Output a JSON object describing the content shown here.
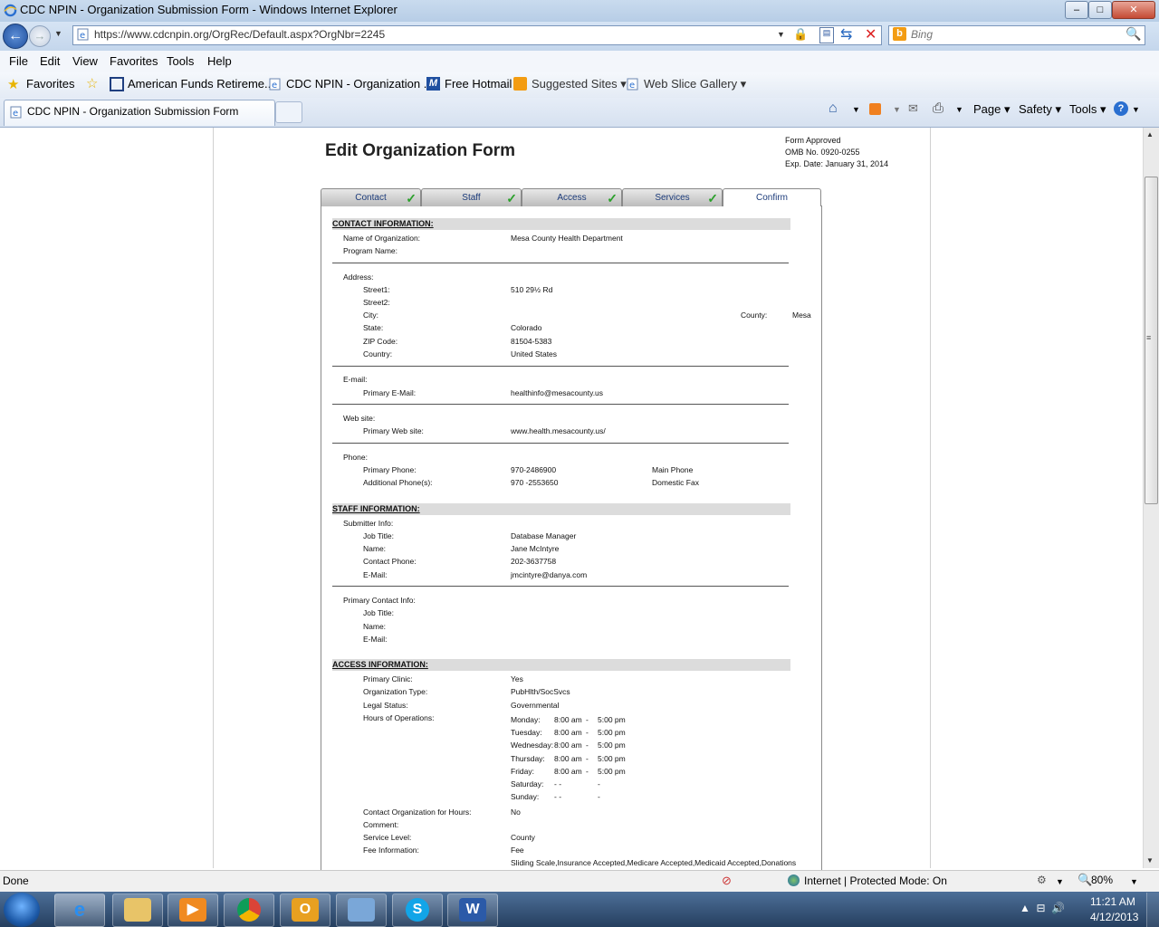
{
  "window": {
    "title": "CDC NPIN - Organization Submission Form - Windows Internet Explorer",
    "controls": {
      "minimize": "–",
      "maximize": "□",
      "close": "✕"
    }
  },
  "nav": {
    "url": "https://www.cdcnpin.org/OrgRec/Default.aspx?OrgNbr=2245",
    "search_placeholder": "Bing"
  },
  "menubar": [
    "File",
    "Edit",
    "View",
    "Favorites",
    "Tools",
    "Help"
  ],
  "favorites_bar": {
    "favorites_label": "Favorites",
    "items": [
      "American Funds Retireme...",
      "CDC NPIN - Organization ...",
      "Free Hotmail",
      "Suggested Sites ▾",
      "Web Slice Gallery ▾"
    ]
  },
  "tabs": {
    "active": "CDC NPIN - Organization Submission Form"
  },
  "command_bar": {
    "page": "Page ▾",
    "safety": "Safety ▾",
    "tools": "Tools ▾"
  },
  "form": {
    "title": "Edit Organization Form",
    "omb": {
      "line1": "Form Approved",
      "line2": "OMB No. 0920-0255",
      "line3": "Exp. Date: January 31, 2014"
    },
    "wizard_tabs": [
      {
        "label": "Contact",
        "done": true
      },
      {
        "label": "Staff",
        "done": true
      },
      {
        "label": "Access",
        "done": true
      },
      {
        "label": "Services",
        "done": true
      },
      {
        "label": "Confirm",
        "done": false
      }
    ],
    "contact": {
      "header": "CONTACT INFORMATION:",
      "org_name_label": "Name of Organization:",
      "org_name": "Mesa County Health Department",
      "program_label": "Program Name:",
      "address_label": "Address:",
      "street1_label": "Street1:",
      "street1": "510 29½ Rd",
      "street2_label": "Street2:",
      "city_label": "City:",
      "county_label": "County:",
      "county": "Mesa",
      "state_label": "State:",
      "state": "Colorado",
      "zip_label": "ZIP Code:",
      "zip": "81504-5383",
      "country_label": "Country:",
      "country": "United States",
      "email_label": "E-mail:",
      "primary_email_label": "Primary E-Mail:",
      "primary_email": "healthinfo@mesacounty.us",
      "web_label": "Web site:",
      "primary_web_label": "Primary Web site:",
      "primary_web": "www.health.mesacounty.us/",
      "phone_label": "Phone:",
      "primary_phone_label": "Primary Phone:",
      "primary_phone": "970-2486900",
      "primary_phone_type": "Main Phone",
      "additional_phone_label": "Additional Phone(s):",
      "additional_phone": "970 -2553650",
      "additional_phone_type": "Domestic Fax"
    },
    "staff": {
      "header": "STAFF INFORMATION:",
      "submitter_label": "Submitter Info:",
      "job_title_label": "Job Title:",
      "job_title": "Database Manager",
      "name_label": "Name:",
      "name": "Jane McIntyre",
      "contact_phone_label": "Contact Phone:",
      "contact_phone": "202-3637758",
      "email_label": "E-Mail:",
      "email": "jmcintyre@danya.com",
      "primary_contact_label": "Primary Contact Info:",
      "pc_job_title_label": "Job Title:",
      "pc_name_label": "Name:",
      "pc_email_label": "E-Mail:"
    },
    "access": {
      "header": "ACCESS INFORMATION:",
      "primary_clinic_label": "Primary Clinic:",
      "primary_clinic": "Yes",
      "org_type_label": "Organization Type:",
      "org_type": "PubHlth/SocSvcs",
      "legal_status_label": "Legal Status:",
      "legal_status": "Governmental",
      "hours_label": "Hours of Operations:",
      "hours": [
        {
          "day": "Monday:",
          "open": "8:00 am",
          "sep": "-",
          "close": "5:00 pm"
        },
        {
          "day": "Tuesday:",
          "open": "8:00 am",
          "sep": "-",
          "close": "5:00 pm"
        },
        {
          "day": "Wednesday:",
          "open": "8:00 am",
          "sep": "-",
          "close": "5:00 pm"
        },
        {
          "day": "Thursday:",
          "open": "8:00 am",
          "sep": "-",
          "close": "5:00 pm"
        },
        {
          "day": "Friday:",
          "open": "8:00 am",
          "sep": "-",
          "close": "5:00 pm"
        },
        {
          "day": "Saturday:",
          "open": "-  -",
          "sep": "-",
          "close": ""
        },
        {
          "day": "Sunday:",
          "open": "-  -",
          "sep": "-",
          "close": ""
        }
      ],
      "contact_hours_label": "Contact Organization for Hours:",
      "contact_hours": "No",
      "comment_label": "Comment:",
      "service_level_label": "Service Level:",
      "service_level": "County",
      "fee_label": "Fee Information:",
      "fee": "Fee",
      "fee_detail": "Sliding Scale,Insurance Accepted,Medicare Accepted,Medicaid Accepted,Donations"
    }
  },
  "status": {
    "text": "Done",
    "zone": "Internet | Protected Mode: On",
    "zoom": "80%"
  },
  "taskbar": {
    "time": "11:21 AM",
    "date": "4/12/2013"
  }
}
